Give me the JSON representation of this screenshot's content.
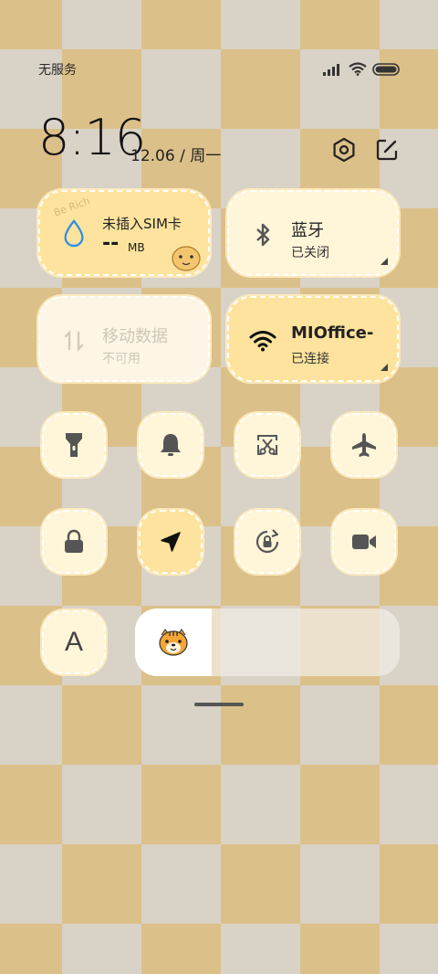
{
  "status_bar": {
    "carrier": "无服务",
    "icons": [
      "signal-icon",
      "wifi-icon",
      "battery-icon"
    ]
  },
  "clock": {
    "time": "8:16",
    "date": "12.06 / 周一"
  },
  "header_actions": [
    "settings-icon",
    "edit-icon"
  ],
  "tiles": {
    "data_usage": {
      "title": "未插入SIM卡",
      "value": "--",
      "unit": "MB",
      "sticker": "Be Rich"
    },
    "bluetooth": {
      "title": "蓝牙",
      "status": "已关闭"
    },
    "mobile_data": {
      "title": "移动数据",
      "status": "不可用"
    },
    "wifi": {
      "title": "MIOffice-",
      "status": "已连接"
    }
  },
  "toggles": [
    {
      "name": "flashlight",
      "icon": "flashlight-icon",
      "active": false
    },
    {
      "name": "mute",
      "icon": "bell-icon",
      "active": false
    },
    {
      "name": "screenshot",
      "icon": "scissors-screenshot-icon",
      "active": false
    },
    {
      "name": "airplane",
      "icon": "airplane-icon",
      "active": false
    },
    {
      "name": "lock-screen",
      "icon": "lock-icon",
      "active": false
    },
    {
      "name": "location",
      "icon": "location-arrow-icon",
      "active": true
    },
    {
      "name": "auto-rotate",
      "icon": "rotation-lock-icon",
      "active": false
    },
    {
      "name": "screen-record",
      "icon": "video-camera-icon",
      "active": false
    }
  ],
  "font_size_toggle": {
    "label": "A"
  },
  "brightness": {
    "level": 0.29,
    "thumb_icon": "tiger-face-icon"
  },
  "colors": {
    "active_tile": "#fde39d",
    "inactive_tile": "#fff5d8",
    "blue_drop": "#2d8de6"
  }
}
